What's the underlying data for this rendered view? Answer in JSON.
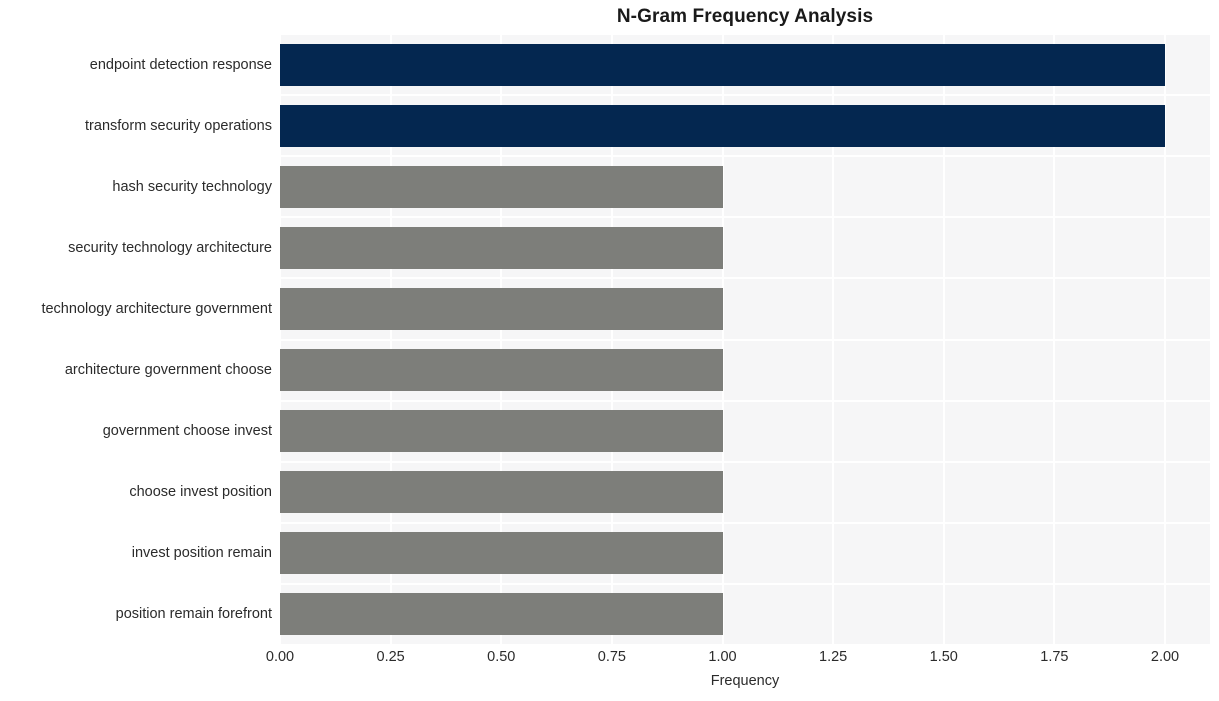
{
  "chart_data": {
    "type": "bar",
    "orientation": "horizontal",
    "title": "N-Gram Frequency Analysis",
    "xlabel": "Frequency",
    "ylabel": "",
    "xlim": [
      0,
      2
    ],
    "ylim": null,
    "grid": true,
    "legend": null,
    "xticks": [
      "0.00",
      "0.25",
      "0.50",
      "0.75",
      "1.00",
      "1.25",
      "1.50",
      "1.75",
      "2.00"
    ],
    "xtick_values": [
      0,
      0.25,
      0.5,
      0.75,
      1,
      1.25,
      1.5,
      1.75,
      2
    ],
    "categories": [
      "endpoint detection response",
      "transform security operations",
      "hash security technology",
      "security technology architecture",
      "technology architecture government",
      "architecture government choose",
      "government choose invest",
      "choose invest position",
      "invest position remain",
      "position remain forefront"
    ],
    "values": [
      2,
      2,
      1,
      1,
      1,
      1,
      1,
      1,
      1,
      1
    ],
    "bar_colors": [
      "#04275099",
      "#042750",
      "#7d7e7a",
      "#7d7e7a",
      "#7d7e7a",
      "#7d7e7a",
      "#7d7e7a",
      "#7d7e7a",
      "#7d7e7a",
      "#7d7e7a"
    ],
    "colors": {
      "highlight": "#042750",
      "default": "#7d7e7a",
      "plot_background": "#f6f6f7",
      "gridline": "#ffffff",
      "figure_background": "#ffffff",
      "text": "#2b2b2b",
      "title_text": "#1a1a1a"
    }
  }
}
